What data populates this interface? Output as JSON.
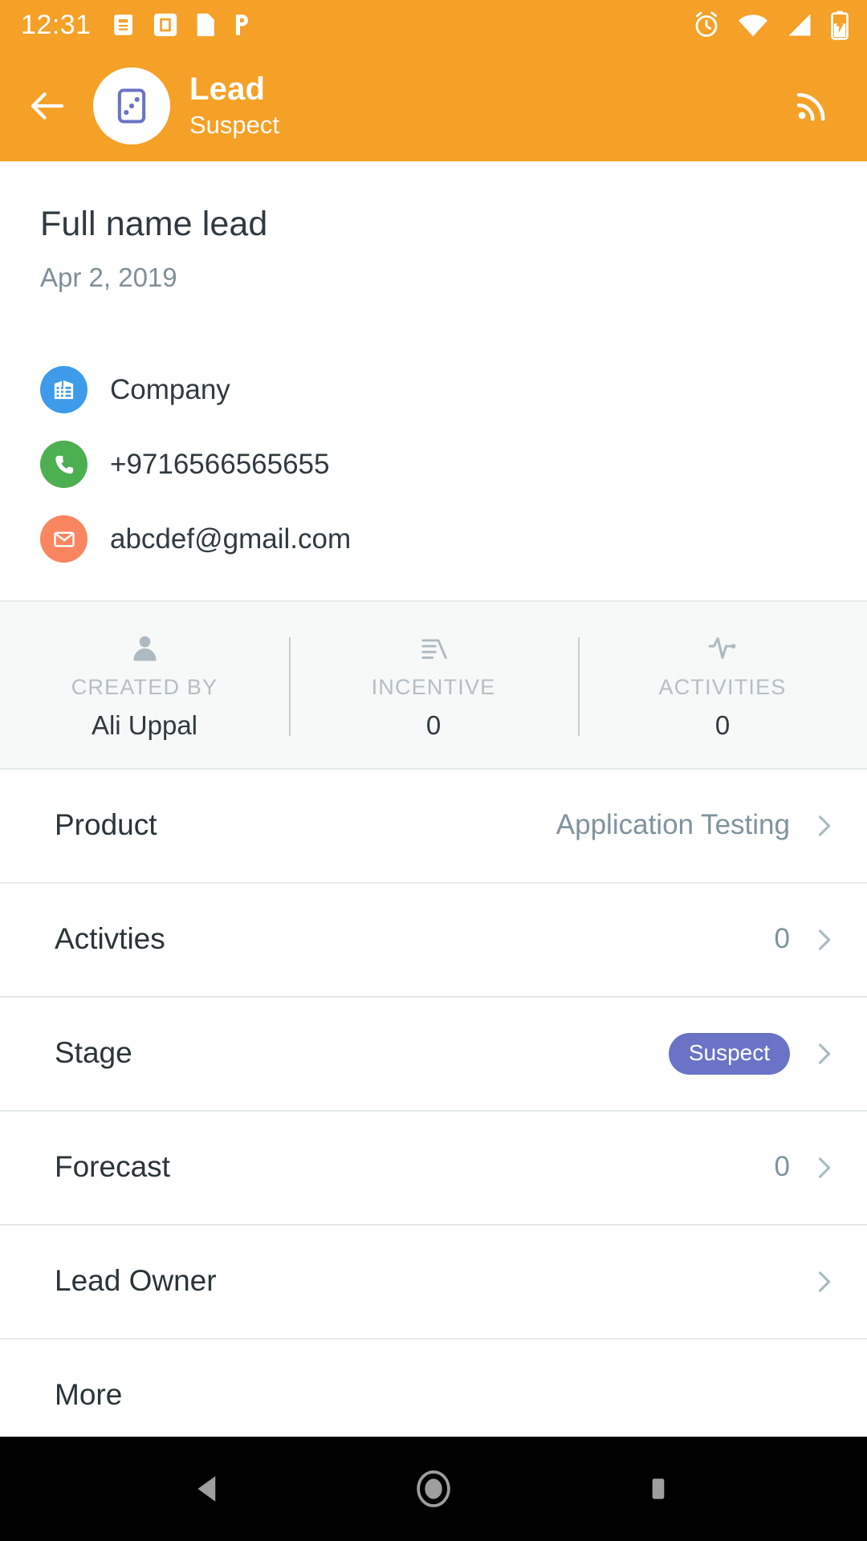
{
  "status_bar": {
    "time": "12:31",
    "left_icons": [
      "news-icon",
      "app-notification-icon",
      "sim-card-icon",
      "p-app-icon"
    ],
    "right_icons": [
      "alarm-icon",
      "wifi-icon",
      "cell-signal-icon",
      "battery-charging-icon"
    ],
    "background_color": "#F5A026"
  },
  "app_bar": {
    "back_icon": "arrow-left-icon",
    "avatar_icon": "lead-card-icon",
    "title": "Lead",
    "subtitle": "Suspect",
    "action_icon": "rss-broadcast-icon",
    "background_color": "#F5A026"
  },
  "hero": {
    "name": "Full name lead",
    "date": "Apr 2, 2019"
  },
  "contacts": [
    {
      "icon": "company-building-icon",
      "icon_color": "#3D9BE9",
      "text": "Company"
    },
    {
      "icon": "phone-icon",
      "icon_color": "#4CAF50",
      "text": "+9716566565655"
    },
    {
      "icon": "email-envelope-icon",
      "icon_color": "#FA8661",
      "text": "abcdef@gmail.com"
    }
  ],
  "stats": [
    {
      "icon": "person-icon",
      "label": "CREATED BY",
      "value": "Ali Uppal"
    },
    {
      "icon": "incentive-document-icon",
      "label": "INCENTIVE",
      "value": "0"
    },
    {
      "icon": "activity-pulse-icon",
      "label": "ACTIVITIES",
      "value": "0"
    }
  ],
  "list_rows": [
    {
      "label": "Product",
      "value": "Application Testing",
      "type": "text"
    },
    {
      "label": "Activties",
      "value": "0",
      "type": "text"
    },
    {
      "label": "Stage",
      "value": "Suspect",
      "type": "badge",
      "badge_color": "#6B73C6"
    },
    {
      "label": "Forecast",
      "value": "0",
      "type": "text"
    },
    {
      "label": "Lead Owner",
      "value": "",
      "type": "empty"
    },
    {
      "label": "More",
      "value": "",
      "type": "empty"
    }
  ],
  "nav_bar": {
    "back": "android-back-icon",
    "home": "android-home-icon",
    "recents": "android-recents-icon"
  }
}
